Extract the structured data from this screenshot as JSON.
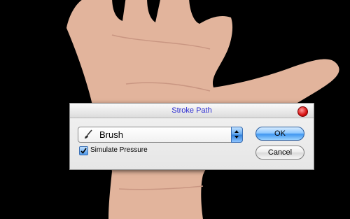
{
  "dialog": {
    "title": "Stroke Path",
    "tool_select": {
      "value": "Brush",
      "icon": "brush-icon"
    },
    "simulate_pressure": {
      "label": "Simulate Pressure",
      "checked": true
    },
    "ok_label": "OK",
    "cancel_label": "Cancel"
  },
  "colors": {
    "title_text": "#2a2ad0",
    "ok_button": "#3f96f0",
    "close_button": "#d81010",
    "background": "#000000"
  }
}
